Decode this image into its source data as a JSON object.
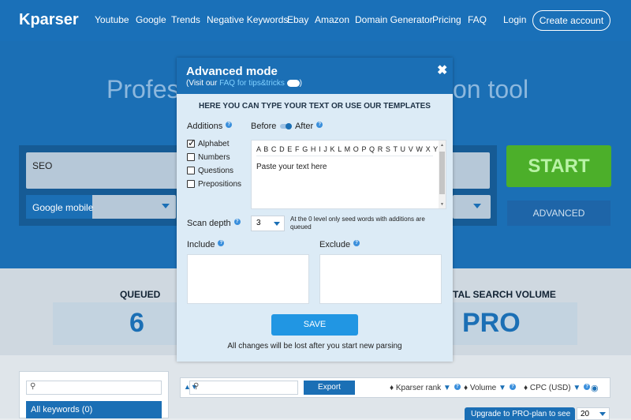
{
  "header": {
    "logo": "Kparser",
    "nav": [
      "Youtube",
      "Google",
      "Trends",
      "Negative Keywords",
      "Ebay",
      "Amazon",
      "Domain Generator",
      "Pricing",
      "FAQ"
    ],
    "login": "Login",
    "create_account": "Create account"
  },
  "hero": {
    "title_left": "Profes",
    "title_right": "on tool",
    "search_value": "SEO",
    "engine_value": "Google mobile",
    "start_label": "START",
    "advanced_label": "ADVANCED"
  },
  "stats": {
    "queued_label": "QUEUED",
    "queued_value": "6",
    "volume_label": "TAL SEARCH VOLUME",
    "volume_value": "PRO"
  },
  "results": {
    "all_keywords": "All keywords (0)",
    "export_label": "Export",
    "columns": [
      "Kparser rank",
      "Volume",
      "CPC (USD)"
    ],
    "upgrade_label": "Upgrade to PRO-plan to see",
    "per_page": "20"
  },
  "modal": {
    "title": "Advanced mode",
    "sub_prefix": "(Visit our ",
    "sub_link": "FAQ for tips&tricks",
    "sub_suffix": ")",
    "heading": "HERE YOU CAN TYPE YOUR TEXT OR USE OUR TEMPLATES",
    "additions_label": "Additions",
    "before_label": "Before",
    "after_label": "After",
    "options": [
      {
        "label": "Alphabet",
        "checked": true
      },
      {
        "label": "Numbers",
        "checked": false
      },
      {
        "label": "Questions",
        "checked": false
      },
      {
        "label": "Prepositions",
        "checked": false
      }
    ],
    "alphabet_text": "A B C D E F G H I J K L M O P Q R S T U V W X Y Z",
    "placeholder_text": "Paste your text here",
    "scan_depth_label": "Scan depth",
    "scan_depth_value": "3",
    "scan_depth_note": "At the 0 level only seed words with additions are queued",
    "include_label": "Include",
    "exclude_label": "Exclude",
    "save_label": "SAVE",
    "footer_note": "All changes will be lost after you start new parsing"
  },
  "colors": {
    "brand_blue": "#1b6fb5",
    "start_green": "#4caf2a",
    "save_blue": "#2196e3",
    "modal_bg": "#dcebf6"
  }
}
